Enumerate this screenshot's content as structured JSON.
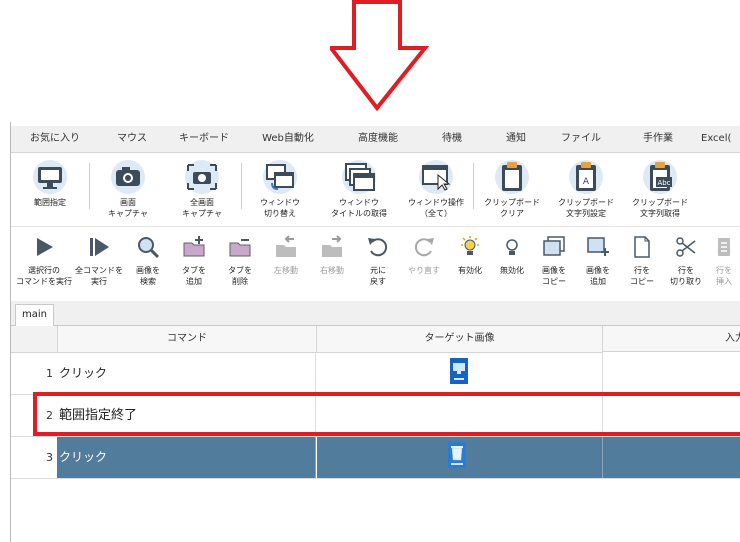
{
  "colors": {
    "annotation_red": "#e01d24",
    "selected_row": "#527c9b",
    "icon_blue": "#3a7bbf"
  },
  "menu": [
    {
      "label": "お気に入り"
    },
    {
      "label": "マウス"
    },
    {
      "label": "キーボード"
    },
    {
      "label": "Web自動化"
    },
    {
      "label": "高度機能"
    },
    {
      "label": "待機"
    },
    {
      "label": "通知"
    },
    {
      "label": "ファイル"
    },
    {
      "label": "手作業"
    },
    {
      "label": "Excel("
    }
  ],
  "ribbon": [
    {
      "label": "範囲指定",
      "icon": "monitor-icon"
    },
    {
      "label": "画面\nキャプチャ",
      "icon": "camera-icon"
    },
    {
      "label": "全画面\nキャプチャ",
      "icon": "fullscreen-camera-icon"
    },
    {
      "label": "ウィンドウ\n切り替え",
      "icon": "window-switch-icon"
    },
    {
      "label": "ウィンドウ\nタイトルの取得",
      "icon": "window-title-icon"
    },
    {
      "label": "ウィンドウ操作\n（全て）",
      "icon": "window-operation-icon"
    },
    {
      "label": "クリップボード\nクリア",
      "icon": "clipboard-clear-icon"
    },
    {
      "label": "クリップボード\n文字列設定",
      "icon": "clipboard-set-icon"
    },
    {
      "label": "クリップボード\n文字列取得",
      "icon": "clipboard-get-icon"
    }
  ],
  "toolbar": [
    {
      "label": "選択行の\nコマンドを実行",
      "icon": "play-icon"
    },
    {
      "label": "全コマンドを\n実行",
      "icon": "play-all-icon"
    },
    {
      "label": "画像を\n検索",
      "icon": "magnifier-icon"
    },
    {
      "label": "タブを\n追加",
      "icon": "folder-add-icon"
    },
    {
      "label": "タブを\n削除",
      "icon": "folder-remove-icon"
    },
    {
      "label": "左移動",
      "icon": "move-left-icon"
    },
    {
      "label": "右移動",
      "icon": "move-right-icon"
    },
    {
      "label": "元に\n戻す",
      "icon": "undo-icon"
    },
    {
      "label": "やり直す",
      "icon": "redo-icon"
    },
    {
      "label": "有効化",
      "icon": "bulb-on-icon"
    },
    {
      "label": "無効化",
      "icon": "bulb-off-icon"
    },
    {
      "label": "画像を\nコピー",
      "icon": "image-copy-icon"
    },
    {
      "label": "画像を\n追加",
      "icon": "image-add-icon"
    },
    {
      "label": "行を\nコピー",
      "icon": "row-copy-icon"
    },
    {
      "label": "行を\n切り取り",
      "icon": "scissors-icon"
    },
    {
      "label": "行を\n挿入",
      "icon": "row-insert-icon"
    }
  ],
  "tabs": [
    {
      "label": "main"
    }
  ],
  "grid": {
    "columns": [
      "コマンド",
      "ターゲット画像",
      "入力"
    ],
    "rows": [
      {
        "num": "1",
        "command": "クリック",
        "target": "desktop-monitor-thumbnail"
      },
      {
        "num": "2",
        "command": "範囲指定終了",
        "target": ""
      },
      {
        "num": "3",
        "command": "クリック",
        "target": "recycle-bin-thumbnail"
      }
    ]
  }
}
